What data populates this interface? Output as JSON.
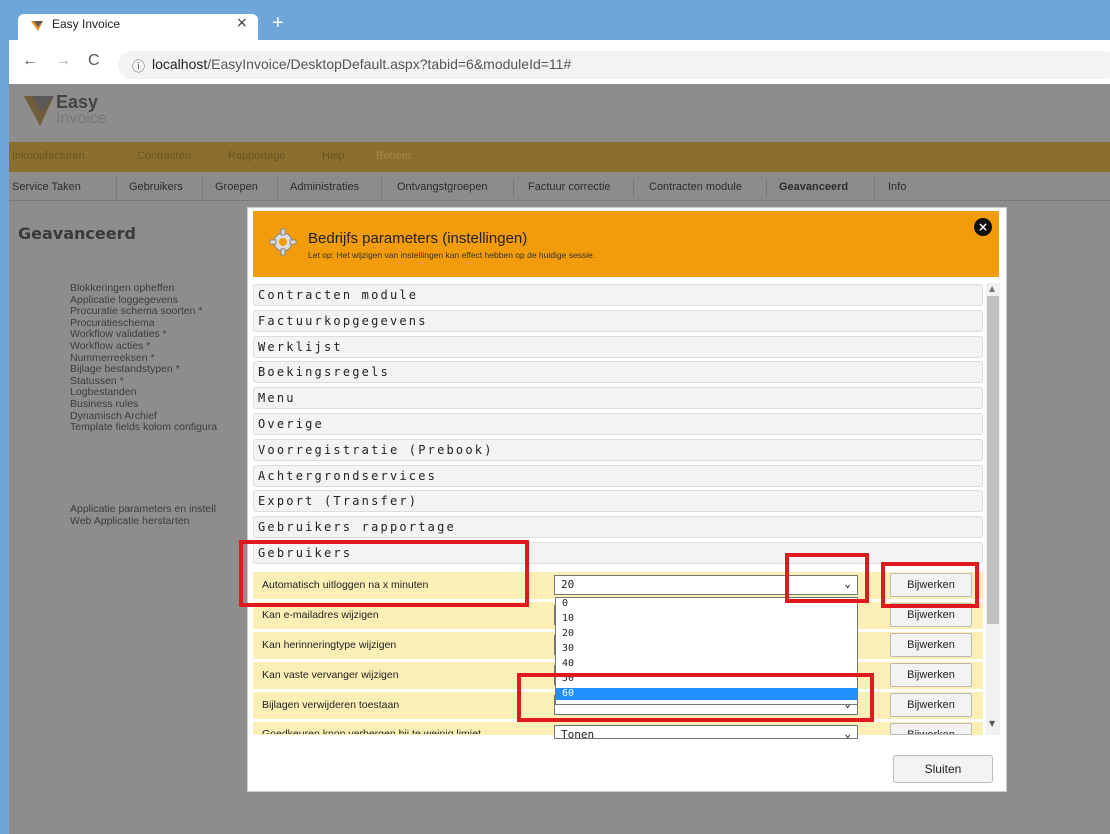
{
  "browser": {
    "tab_title": "Easy Invoice",
    "tab_close": "×",
    "new_tab": "+",
    "back": "←",
    "forward": "→",
    "reload": "C",
    "info": "ⓘ",
    "url_host": "localhost",
    "url_path": "/EasyInvoice/DesktopDefault.aspx?tabid=6&moduleId=11#"
  },
  "logo": {
    "line1": "Easy",
    "line2": "Invoice"
  },
  "menu": [
    "Inkoopfacturen",
    "Contracten",
    "Rapportage",
    "Help",
    "Beheer"
  ],
  "submenu": [
    "Service Taken",
    "Gebruikers",
    "Groepen",
    "Administraties",
    "Ontvangstgroepen",
    "Factuur correctie",
    "Contracten module",
    "Geavanceerd",
    "Info"
  ],
  "page": {
    "title": "Geavanceerd",
    "links": [
      "Blokkeringen opheffen",
      "Applicatie loggegevens",
      "Procuratie schema soorten *",
      "Procuratieschema",
      "Workflow validaties *",
      "Workflow acties *",
      "Nummerreeksen *",
      "Bijlage bestandstypen *",
      "Statussen *",
      "Logbestanden",
      "Business rules",
      "Dynamisch Archief",
      "Template fields kolom configura"
    ],
    "links2": [
      "Applicatie parameters en instell",
      "Web Applicatie herstarten"
    ]
  },
  "modal": {
    "title": "Bedrijfs parameters (instellingen)",
    "subtitle": "Let op: Het wijzigen van instellingen kan effect hebben op de huidige sessie.",
    "close": "×",
    "sections": [
      "Contracten module",
      "Factuurkopgegevens",
      "Werklijst",
      "Boekingsregels",
      "Menu",
      "Overige",
      "Voorregistratie (Prebook)",
      "Achtergrondservices",
      "Export (Transfer)",
      "Gebruikers rapportage",
      "Gebruikers"
    ],
    "rows": [
      {
        "label": "Automatisch uitloggen na x minuten",
        "value": "20",
        "button": "Bijwerken"
      },
      {
        "label": "Kan e-mailadres wijzigen",
        "value": "",
        "button": "Bijwerken"
      },
      {
        "label": "Kan herinneringtype wijzigen",
        "value": "",
        "button": "Bijwerken"
      },
      {
        "label": "Kan vaste vervanger wijzigen",
        "value": "",
        "button": "Bijwerken"
      },
      {
        "label": "Bijlagen verwijderen toestaan",
        "value": "",
        "button": "Bijwerken"
      },
      {
        "label": "Goedkeuren knop verbergen bij te weinig limiet",
        "value": "Tonen",
        "button": "Bijwerken"
      }
    ],
    "dropdown_options": [
      "0",
      "10",
      "20",
      "30",
      "40",
      "50",
      "60"
    ],
    "dropdown_selected": "60",
    "close_button": "Sluiten"
  },
  "colors": {
    "accent": "#f29c0b",
    "highlight": "#e0191e",
    "row_bg": "#fbefb6",
    "selected_option": "#1e90ff"
  }
}
